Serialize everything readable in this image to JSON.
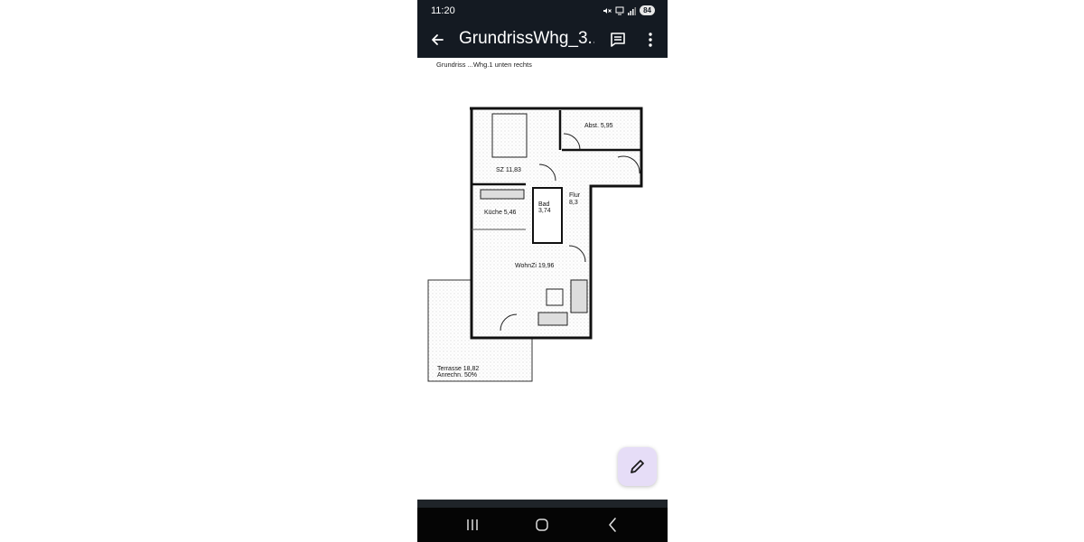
{
  "status_bar": {
    "time": "11:20",
    "battery": "84"
  },
  "app_bar": {
    "title": "GrundrissWhg_3..."
  },
  "document": {
    "header_text": "Grundriss ...Whg.1 unten rechts",
    "rooms": [
      {
        "id": "abst",
        "label": "Abst. 5,95"
      },
      {
        "id": "sz",
        "label": "SZ 11,83"
      },
      {
        "id": "flur1",
        "label": "Flur"
      },
      {
        "id": "flur2",
        "label": "8,3"
      },
      {
        "id": "bad1",
        "label": "Bad"
      },
      {
        "id": "bad2",
        "label": "3,74"
      },
      {
        "id": "kueche",
        "label": "Küche 5,46"
      },
      {
        "id": "wohn",
        "label": "WohnZi 19,96"
      },
      {
        "id": "terr1",
        "label": "Terrasse 18,82"
      },
      {
        "id": "terr2",
        "label": "Anrechn. 50%"
      }
    ]
  },
  "icons": {
    "back": "arrow-left-icon",
    "comment": "comment-icon",
    "more": "more-vert-icon",
    "edit": "pencil-icon",
    "recents": "recents-icon",
    "home": "home-icon",
    "nav_back": "chevron-left-icon"
  },
  "colors": {
    "bar": "#141a22",
    "fab": "#e6ddf7",
    "nav": "#050505"
  }
}
